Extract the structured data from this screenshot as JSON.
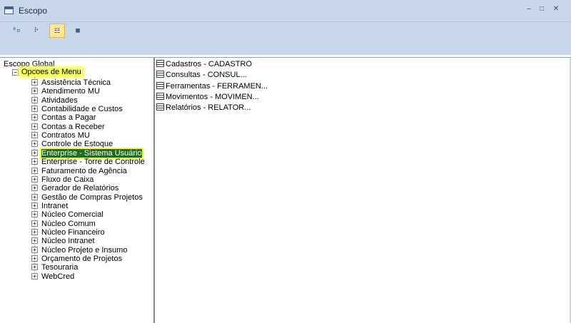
{
  "window": {
    "title": "Escopo",
    "minimize": "–",
    "maximize": "□",
    "close": "✕"
  },
  "toolbar": {
    "buttons": [
      {
        "name": "large-icons",
        "glyph": "ᴰ▫"
      },
      {
        "name": "small-icons",
        "glyph": "⠗"
      },
      {
        "name": "list-view",
        "glyph": "☷"
      },
      {
        "name": "details-view",
        "glyph": "▦"
      }
    ]
  },
  "tree": {
    "root": "Escopo Global",
    "group": "Opcoes de Menu",
    "items": [
      "Assistência Técnica",
      "Atendimento MU",
      "Atividades",
      "Contabilidade e Custos",
      "Contas a Pagar",
      "Contas a Receber",
      "Contratos MU",
      "Controle de Estoque",
      "Enterprise - Sistema Usuário",
      "Enterprise - Torre de Controle",
      "Faturamento de Agência",
      "Fluxo de Caixa",
      "Gerador de Relatórios",
      "Gestão de Compras Projetos",
      "Intranet",
      "Núcleo Comercial",
      "Núcleo Comum",
      "Núcleo Financeiro",
      "Núcleo Intranet",
      "Núcleo Projeto e Insumo",
      "Orçamento de Projetos",
      "Tesouraria",
      "WebCred"
    ],
    "expander_plus": "+",
    "expander_minus": "−"
  },
  "list": {
    "items": [
      "Cadastros - CADASTRO",
      "Consultas - CONSUL...",
      "Ferramentas - FERRAMEN...",
      "Movimentos - MOVIMEN...",
      "Relatórios - RELATOR..."
    ]
  }
}
